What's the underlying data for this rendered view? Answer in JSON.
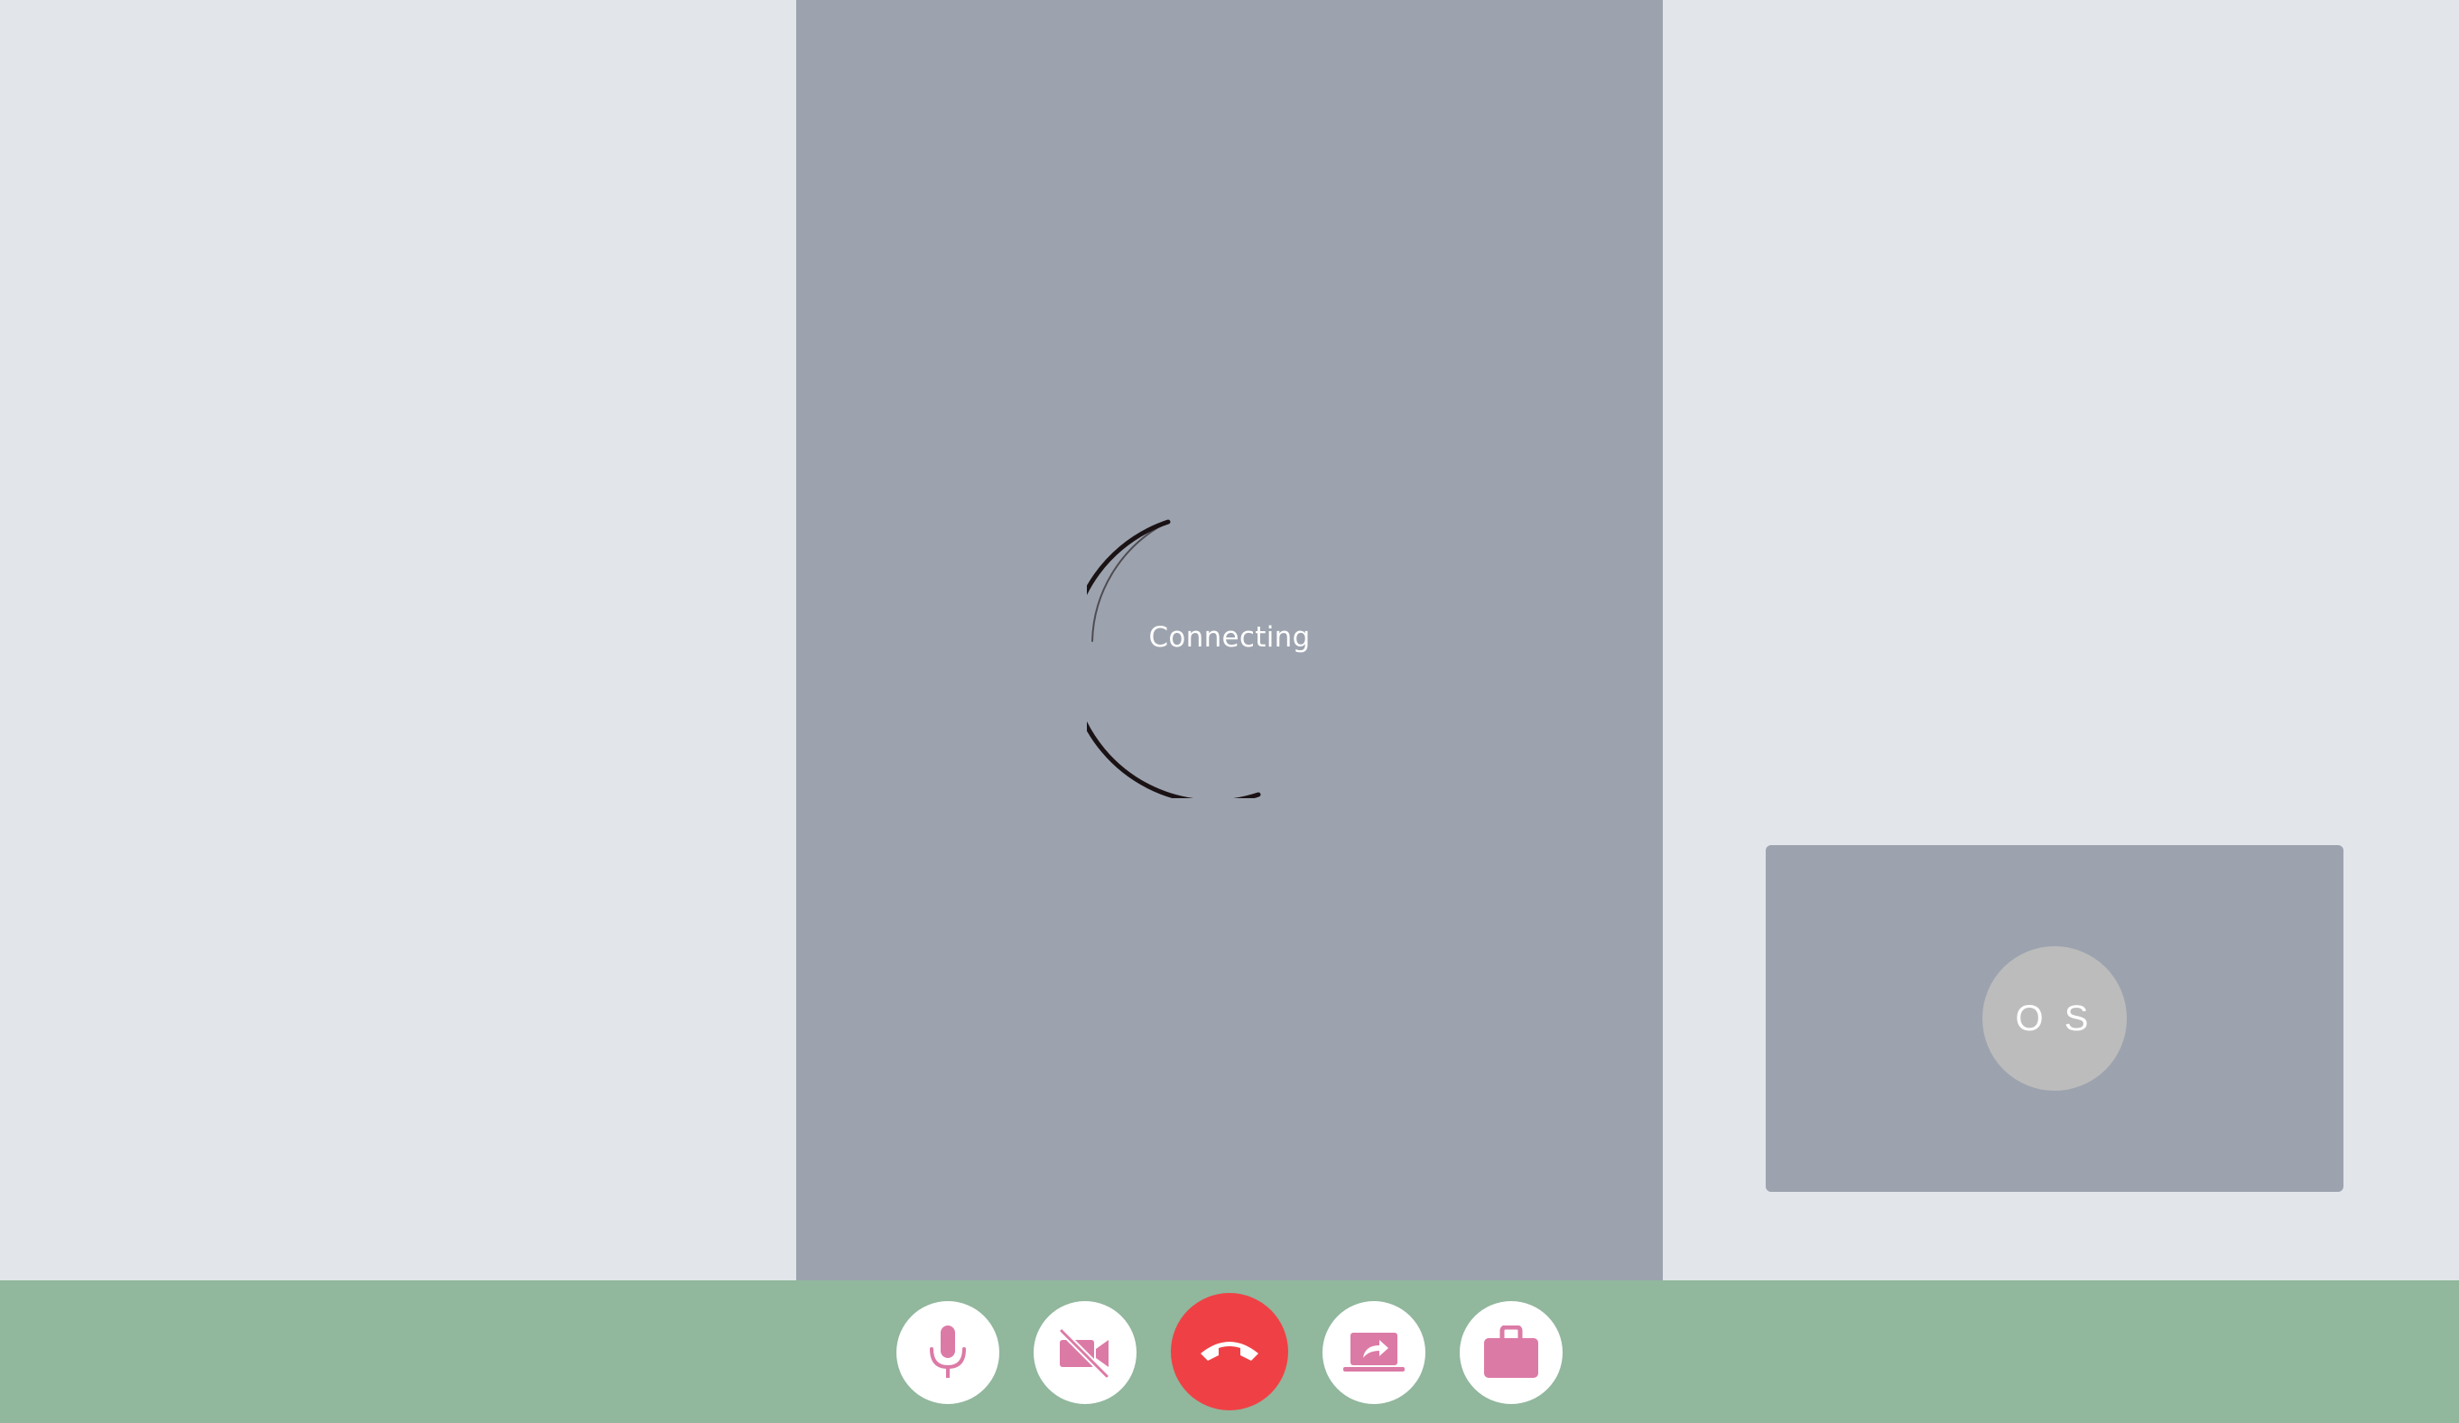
{
  "call": {
    "status_text": "Connecting",
    "self_initials": "O S"
  },
  "controls": [
    {
      "id": "microphone",
      "icon": "microphone-icon"
    },
    {
      "id": "camera",
      "icon": "video-off-icon"
    },
    {
      "id": "hang-up",
      "icon": "phone-hangup-icon"
    },
    {
      "id": "share-screen",
      "icon": "screen-share-icon"
    },
    {
      "id": "briefcase",
      "icon": "briefcase-icon"
    }
  ],
  "colors": {
    "background": "#e2e6eb",
    "video_tile": "#9ca3ae",
    "control_bar": "#91b79d",
    "icon_accent": "#dc7aa6",
    "hangup": "#ef4145",
    "avatar": "#bcbcbc"
  }
}
